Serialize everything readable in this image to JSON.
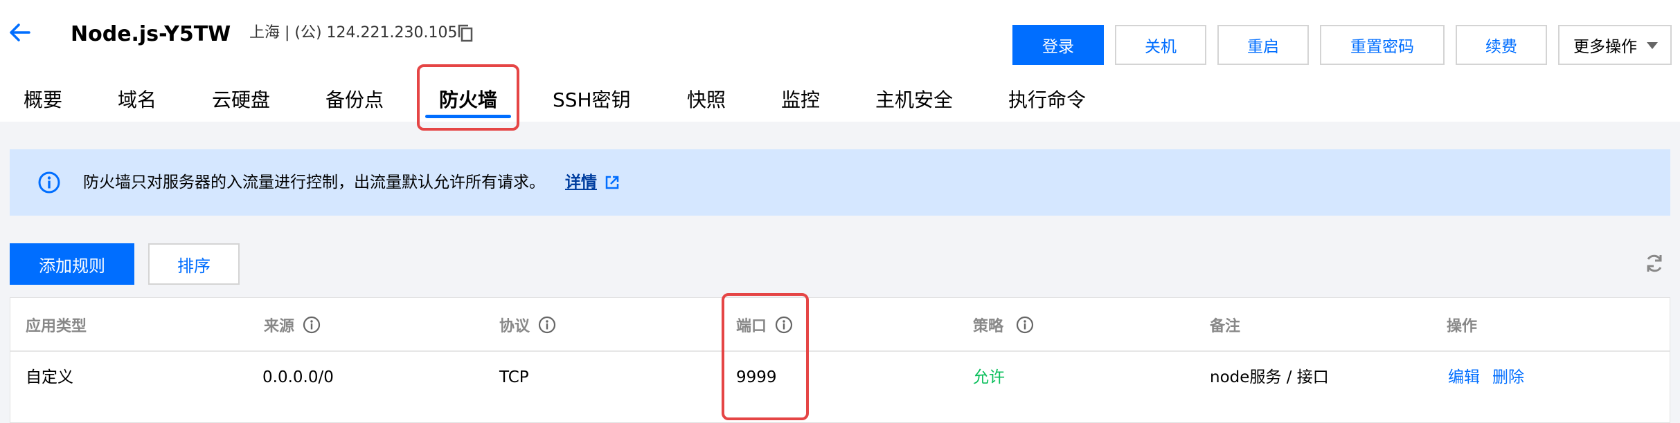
{
  "header": {
    "title": "Node.js-Y5TW",
    "region_ip": "上海 | (公) 124.221.230.105",
    "back_icon": "arrow-left-icon",
    "copy_icon": "copy-icon"
  },
  "actions": {
    "login": "登录",
    "shutdown": "关机",
    "restart": "重启",
    "reset_password": "重置密码",
    "renew": "续费",
    "more": "更多操作"
  },
  "tabs": [
    "概要",
    "域名",
    "云硬盘",
    "备份点",
    "防火墙",
    "SSH密钥",
    "快照",
    "监控",
    "主机安全",
    "执行命令"
  ],
  "active_tab": "防火墙",
  "notice": {
    "text": "防火墙只对服务器的入流量进行控制，出流量默认允许所有请求。",
    "link": "详情",
    "icon": "info-icon",
    "link_icon": "external-link-icon"
  },
  "toolbar": {
    "add_rule": "添加规则",
    "sort": "排序",
    "refresh_icon": "refresh-icon"
  },
  "table": {
    "headers": [
      "应用类型",
      "来源",
      "协议",
      "端口",
      "策略",
      "备注",
      "操作"
    ],
    "rows": [
      {
        "app_type": "自定义",
        "source": "0.0.0.0/0",
        "protocol": "TCP",
        "port": "9999",
        "policy": "允许",
        "remark": "node服务 / 接口",
        "edit": "编辑",
        "delete": "删除"
      }
    ]
  },
  "colors": {
    "primary": "#006eff",
    "allow": "#0abf5b",
    "highlight": "#e54545",
    "notice_bg": "#d5e7ff"
  }
}
